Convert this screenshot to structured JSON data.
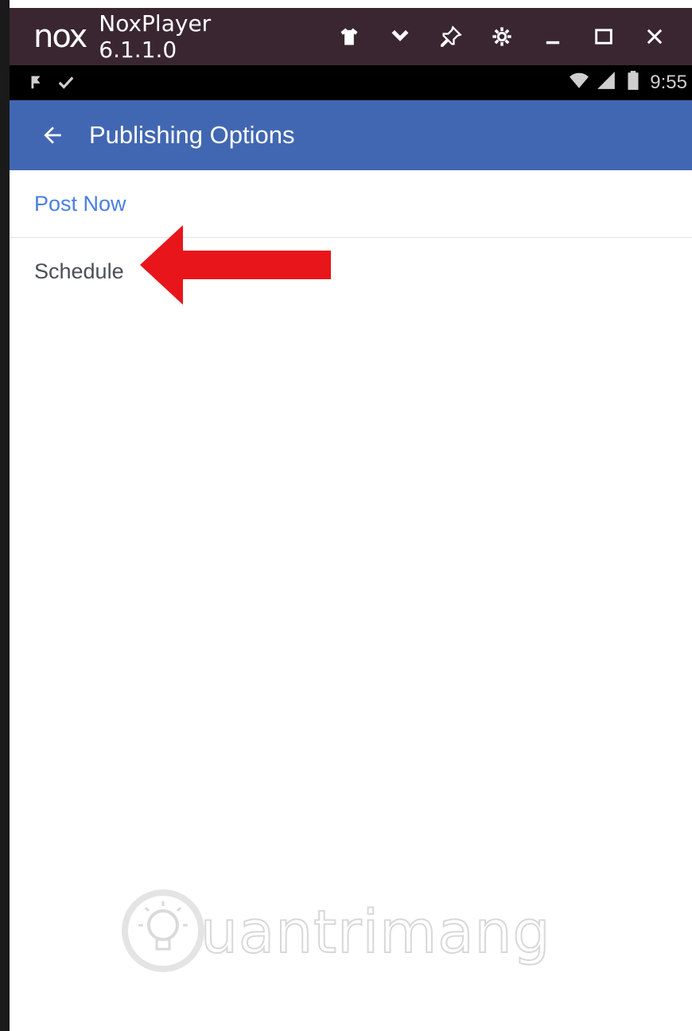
{
  "window": {
    "logo_text": "nox",
    "title": "NoxPlayer 6.1.1.0",
    "toolbar_icons": [
      "shirt-icon",
      "chevron-down-icon",
      "pin-icon",
      "gear-icon",
      "minimize-icon",
      "maximize-icon",
      "close-icon"
    ]
  },
  "status_bar": {
    "left_icons": [
      "notification-flag-icon",
      "check-icon"
    ],
    "right_icons": [
      "wifi-icon",
      "signal-icon",
      "battery-icon"
    ],
    "time": "9:55"
  },
  "app_bar": {
    "title": "Publishing Options",
    "color": "#4267b2"
  },
  "options": [
    {
      "label": "Post Now",
      "color": "#4a7fe0"
    },
    {
      "label": "Schedule",
      "color": "#4b4f56"
    }
  ],
  "annotation": {
    "type": "red-arrow",
    "color": "#e8161b",
    "points_to": "Schedule"
  },
  "watermark": {
    "text": "uantrimang"
  }
}
